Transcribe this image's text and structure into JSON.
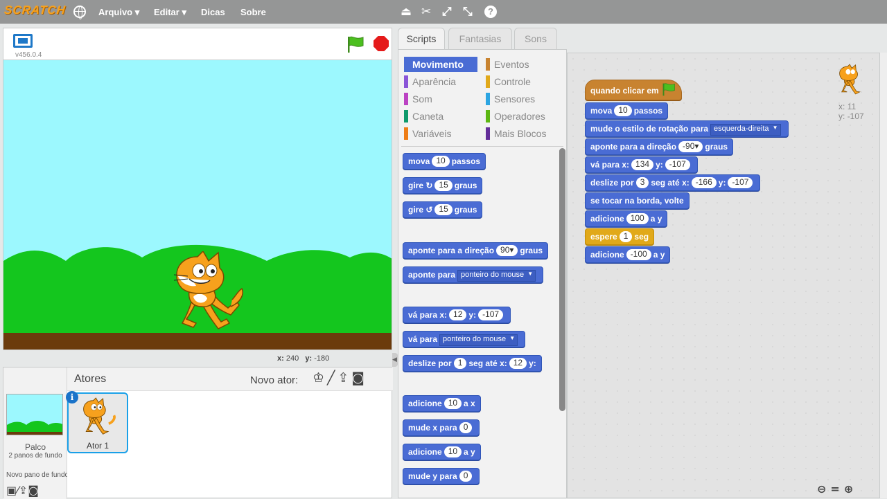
{
  "app": {
    "logo": "SCRATCH",
    "version": "v456.0.4"
  },
  "menu": {
    "arquivo": "Arquivo",
    "editar": "Editar",
    "dicas": "Dicas",
    "sobre": "Sobre"
  },
  "toolbar_icons": [
    "duplicate-icon",
    "delete-icon",
    "grow-icon",
    "shrink-icon",
    "help-icon"
  ],
  "stage": {
    "x_label": "x:",
    "x_value": "240",
    "y_label": "y:",
    "y_value": "-180"
  },
  "sprites": {
    "header": "Atores",
    "new_sprite_label": "Novo ator:",
    "stage_label": "Palco",
    "stage_backdrops": "2 panos de fundo",
    "new_backdrop_label": "Novo pano de fundo:",
    "items": [
      {
        "name": "Ator 1"
      }
    ]
  },
  "tabs": [
    "Scripts",
    "Fantasias",
    "Sons"
  ],
  "categories": [
    {
      "label": "Movimento",
      "color": "#4a6cd4"
    },
    {
      "label": "Eventos",
      "color": "#c88330"
    },
    {
      "label": "Aparência",
      "color": "#8a55d7"
    },
    {
      "label": "Controle",
      "color": "#e1a91a"
    },
    {
      "label": "Som",
      "color": "#bb42c3"
    },
    {
      "label": "Sensores",
      "color": "#2ca5e2"
    },
    {
      "label": "Caneta",
      "color": "#0e9a6c"
    },
    {
      "label": "Operadores",
      "color": "#5cb712"
    },
    {
      "label": "Variáveis",
      "color": "#ee7d16"
    },
    {
      "label": "Mais Blocos",
      "color": "#632d99"
    }
  ],
  "palette_blocks": {
    "b1": {
      "a": "mova",
      "n1": "10",
      "b": "passos"
    },
    "b2": {
      "a": "gire",
      "n1": "15",
      "b": "graus"
    },
    "b3": {
      "a": "gire",
      "n1": "15",
      "b": "graus"
    },
    "b4": {
      "a": "aponte para a direção",
      "n1": "90▾",
      "b": "graus"
    },
    "b5": {
      "a": "aponte para",
      "d1": "ponteiro do mouse"
    },
    "b6": {
      "a": "vá para x:",
      "n1": "12",
      "b": "y:",
      "n2": "-107"
    },
    "b7": {
      "a": "vá para",
      "d1": "ponteiro do mouse"
    },
    "b8": {
      "a": "deslize por",
      "n1": "1",
      "b": "seg até x:",
      "n2": "12",
      "c": "y:"
    },
    "b9": {
      "a": "adicione",
      "n1": "10",
      "b": "a x"
    },
    "b10": {
      "a": "mude x para",
      "n1": "0"
    },
    "b11": {
      "a": "adicione",
      "n1": "10",
      "b": "a y"
    },
    "b12": {
      "a": "mude y para",
      "n1": "0"
    }
  },
  "script": {
    "s0": {
      "a": "quando clicar em"
    },
    "s1": {
      "a": "mova",
      "n1": "10",
      "b": "passos"
    },
    "s2": {
      "a": "mude o estilo de rotação para",
      "d1": "esquerda-direita"
    },
    "s3": {
      "a": "aponte para a direção",
      "n1": "-90▾",
      "b": "graus"
    },
    "s4": {
      "a": "vá para x:",
      "n1": "134",
      "b": "y:",
      "n2": "-107"
    },
    "s5": {
      "a": "deslize por",
      "n1": "3",
      "b": "seg até x:",
      "n2": "-166",
      "c": "y:",
      "n3": "-107"
    },
    "s6": {
      "a": "se tocar na borda, volte"
    },
    "s7": {
      "a": "adicione",
      "n1": "100",
      "b": "a y"
    },
    "s8": {
      "a": "espere",
      "n1": "1",
      "b": "seg"
    },
    "s9": {
      "a": "adicione",
      "n1": "-100",
      "b": "a y"
    }
  },
  "sprite_info": {
    "x_label": "x:",
    "x_value": "11",
    "y_label": "y:",
    "y_value": "-107"
  }
}
